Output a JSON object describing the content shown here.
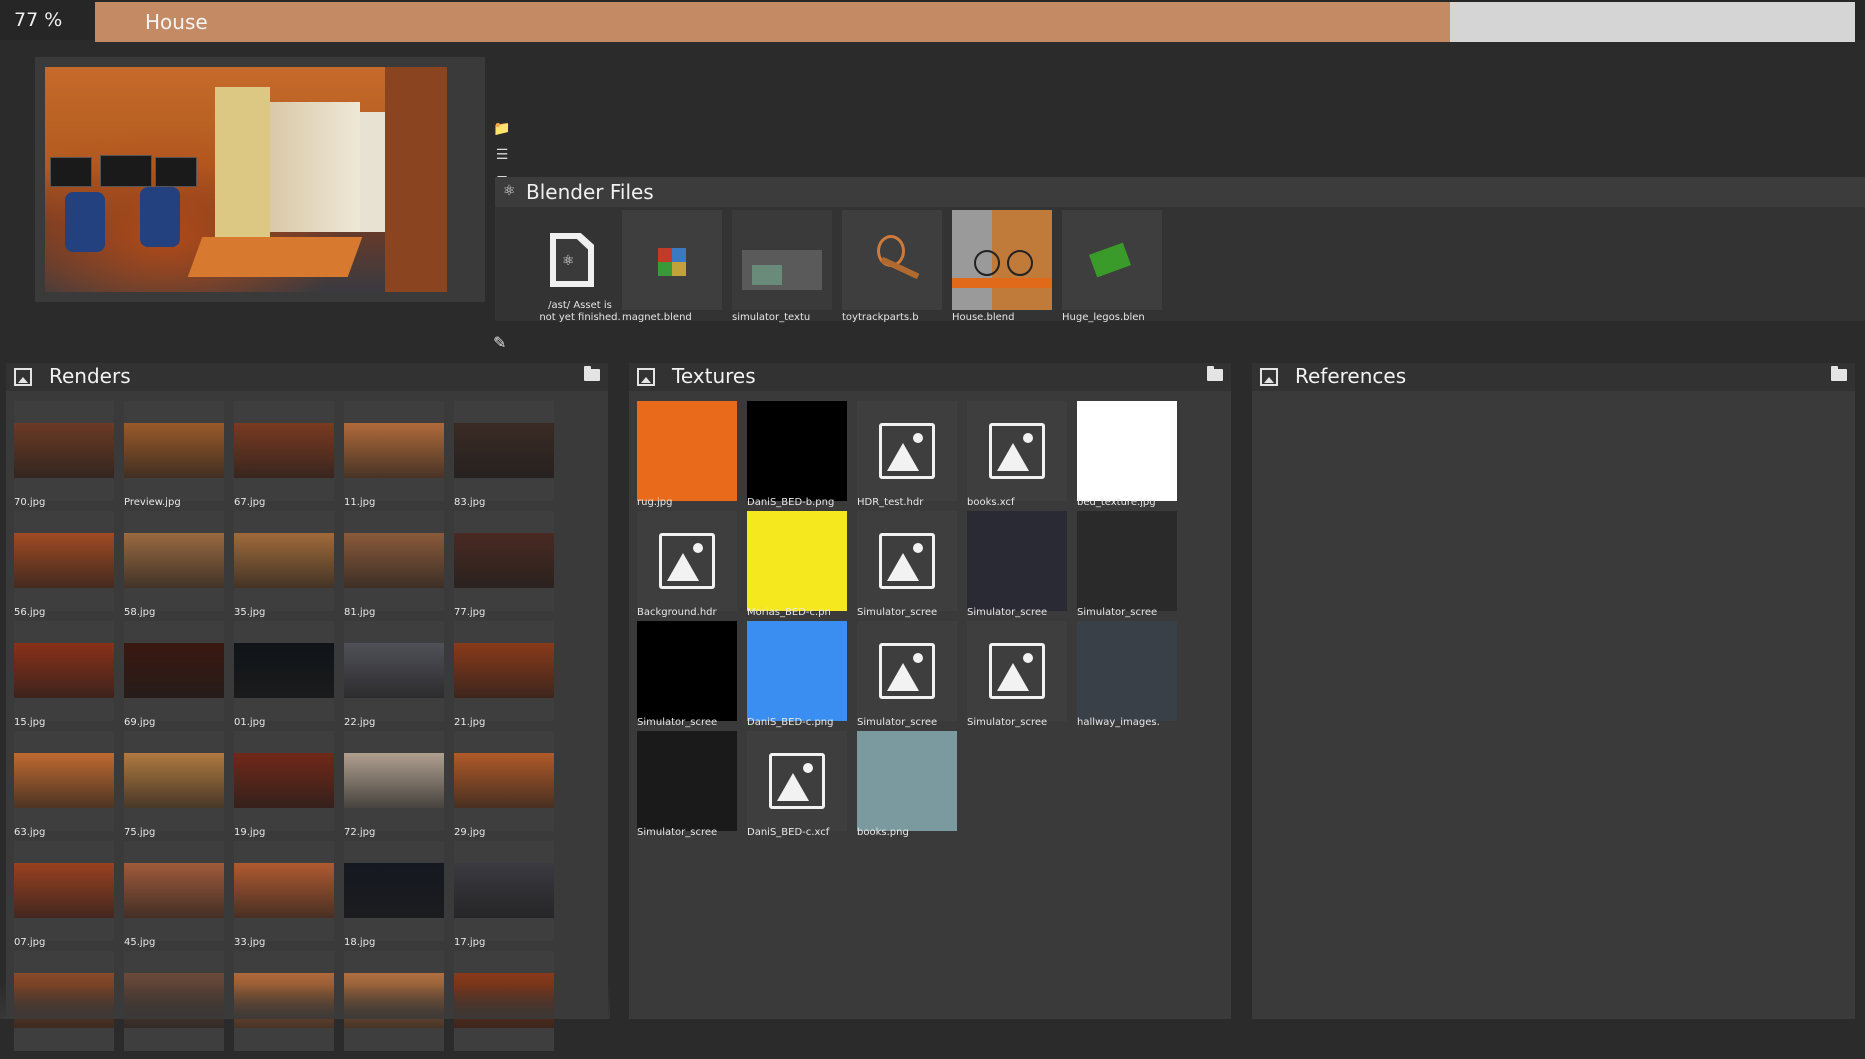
{
  "progress": {
    "percent_text": "77 %",
    "value": 0.77,
    "asset_name": "House",
    "fill_color": "#c48a64",
    "track_color": "#d5d5d5"
  },
  "preview": {
    "tools": [
      "folder-icon",
      "tree-icon",
      "add-asset-icon"
    ],
    "edit_icon": "pencil-icon"
  },
  "blender_files": {
    "title": "Blender Files",
    "placeholder": {
      "line1": "/ast/ Asset is",
      "line2": "not yet finished."
    },
    "items": [
      {
        "label": "magnet.blend"
      },
      {
        "label": "simulator_textu"
      },
      {
        "label": "toytrackparts.b"
      },
      {
        "label": "House.blend"
      },
      {
        "label": "Huge_legos.blen"
      }
    ]
  },
  "renders": {
    "title": "Renders",
    "items": [
      {
        "label": "70.jpg",
        "color": "#6a3a24"
      },
      {
        "label": "Preview.jpg",
        "color": "#9a5a2a"
      },
      {
        "label": "67.jpg",
        "color": "#7a3a20"
      },
      {
        "label": "11.jpg",
        "color": "#b06a3a"
      },
      {
        "label": "83.jpg",
        "color": "#3a2a24"
      },
      {
        "label": "56.jpg",
        "color": "#a04a22"
      },
      {
        "label": "58.jpg",
        "color": "#9a6a40"
      },
      {
        "label": "35.jpg",
        "color": "#a06a3a"
      },
      {
        "label": "81.jpg",
        "color": "#8a5a3a"
      },
      {
        "label": "77.jpg",
        "color": "#4a2a22"
      },
      {
        "label": "15.jpg",
        "color": "#8a3018"
      },
      {
        "label": "69.jpg",
        "color": "#3a1810"
      },
      {
        "label": "01.jpg",
        "color": "#101418"
      },
      {
        "label": "22.jpg",
        "color": "#505058"
      },
      {
        "label": "21.jpg",
        "color": "#8a3a1a"
      },
      {
        "label": "63.jpg",
        "color": "#c06a30"
      },
      {
        "label": "75.jpg",
        "color": "#b07a40"
      },
      {
        "label": "19.jpg",
        "color": "#702818"
      },
      {
        "label": "72.jpg",
        "color": "#b0a090"
      },
      {
        "label": "29.jpg",
        "color": "#b05a28"
      },
      {
        "label": "07.jpg",
        "color": "#9a4020"
      },
      {
        "label": "45.jpg",
        "color": "#a05a3a"
      },
      {
        "label": "33.jpg",
        "color": "#b05a30"
      },
      {
        "label": "18.jpg",
        "color": "#141820"
      },
      {
        "label": "17.jpg",
        "color": "#3a3a40"
      },
      {
        "label": "",
        "color": "#8a4a28"
      },
      {
        "label": "",
        "color": "#6a4a3a"
      },
      {
        "label": "",
        "color": "#b06a3a"
      },
      {
        "label": "",
        "color": "#b07040"
      },
      {
        "label": "",
        "color": "#8a3a1a"
      }
    ]
  },
  "textures": {
    "title": "Textures",
    "items": [
      {
        "label": "rug.jpg",
        "kind": "image",
        "color": "#e86a1a"
      },
      {
        "label": "DaniS_BED-b.png",
        "kind": "image",
        "color": "#000000"
      },
      {
        "label": "HDR_test.hdr",
        "kind": "placeholder"
      },
      {
        "label": "books.xcf",
        "kind": "placeholder"
      },
      {
        "label": "bed_texture.jpg",
        "kind": "image",
        "color": "#ffffff"
      },
      {
        "label": "Background.hdr",
        "kind": "placeholder"
      },
      {
        "label": "Morias_BED-c.pn",
        "kind": "image",
        "color": "#f6e81e"
      },
      {
        "label": "Simulator_scree",
        "kind": "placeholder"
      },
      {
        "label": "Simulator_scree",
        "kind": "image",
        "color": "#2a2a34"
      },
      {
        "label": "Simulator_scree",
        "kind": "image",
        "color": "#2a2a2a"
      },
      {
        "label": "Simulator_scree",
        "kind": "image",
        "color": "#000000"
      },
      {
        "label": "DaniS_BED-c.png",
        "kind": "image",
        "color": "#3a8ef2"
      },
      {
        "label": "Simulator_scree",
        "kind": "placeholder"
      },
      {
        "label": "Simulator_scree",
        "kind": "placeholder"
      },
      {
        "label": "hallway_images.",
        "kind": "image",
        "color": "#3a4048"
      },
      {
        "label": "Simulator_scree",
        "kind": "image",
        "color": "#1a1a1a"
      },
      {
        "label": "DaniS_BED-c.xcf",
        "kind": "placeholder"
      },
      {
        "label": "books.png",
        "kind": "image",
        "color": "#7a9aa0"
      }
    ]
  },
  "references": {
    "title": "References",
    "items": []
  }
}
